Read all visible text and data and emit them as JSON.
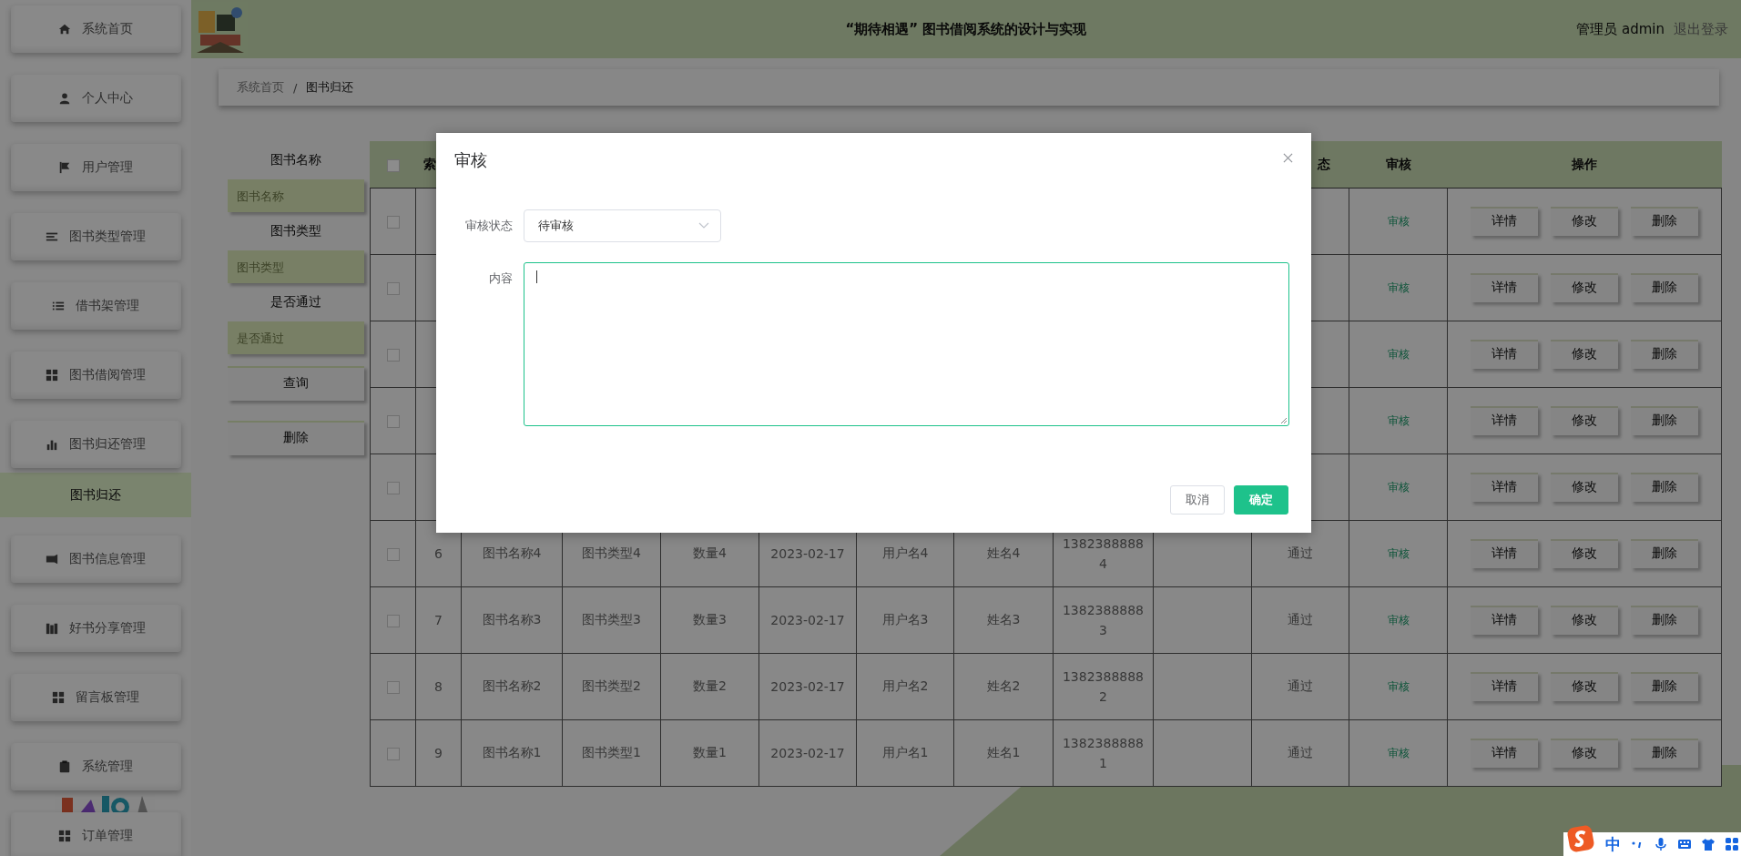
{
  "sidebar": {
    "items": [
      {
        "label": "系统首页",
        "selected": false
      },
      {
        "label": "个人中心",
        "selected": false
      },
      {
        "label": "用户管理",
        "selected": false
      },
      {
        "label": "图书类型管理",
        "selected": false
      },
      {
        "label": "借书架管理",
        "selected": false
      },
      {
        "label": "图书借阅管理",
        "selected": false
      },
      {
        "label": "图书归还管理",
        "selected": false
      },
      {
        "label": "图书归还",
        "selected": true
      },
      {
        "label": "图书信息管理",
        "selected": false
      },
      {
        "label": "好书分享管理",
        "selected": false
      },
      {
        "label": "留言板管理",
        "selected": false
      },
      {
        "label": "系统管理",
        "selected": false
      },
      {
        "label": "订单管理",
        "selected": false
      }
    ]
  },
  "header": {
    "title": "“期待相遇” 图书借阅系统的设计与实现",
    "user": "管理员 admin",
    "logout": "退出登录"
  },
  "breadcrumb": [
    {
      "label": "系统首页"
    },
    {
      "label": "图书归还"
    }
  ],
  "breadcrumb_separator": "/",
  "search": {
    "fields": [
      {
        "label": "图书名称",
        "placeholder": "图书名称"
      },
      {
        "label": "图书类型",
        "placeholder": "图书类型"
      },
      {
        "label": "是否通过",
        "placeholder": "是否通过"
      }
    ],
    "buttons": [
      "查询",
      "删除"
    ]
  },
  "table": {
    "header_checked": false,
    "columns": [
      {
        "label": "索"
      },
      {
        "label": "态"
      },
      {
        "label": "审核"
      },
      {
        "label": "操作"
      }
    ],
    "rows": [
      {
        "checked": false,
        "review": "审核",
        "actions": [
          "详情",
          "修改",
          "删除"
        ]
      },
      {
        "checked": false,
        "review": "审核",
        "actions": [
          "详情",
          "修改",
          "删除"
        ]
      },
      {
        "checked": false,
        "review": "审核",
        "actions": [
          "详情",
          "修改",
          "删除"
        ]
      },
      {
        "checked": false,
        "review": "审核",
        "actions": [
          "详情",
          "修改",
          "删除"
        ]
      },
      {
        "checked": false,
        "review": "审核",
        "actions": [
          "详情",
          "修改",
          "删除"
        ]
      },
      {
        "checked": false,
        "cells": [
          "6",
          "图书名称4",
          "图书类型4",
          "数量4",
          "2023-02-17",
          "用户名4",
          "姓名4",
          "13823888884",
          "",
          "通过"
        ],
        "review": "审核",
        "actions": [
          "详情",
          "修改",
          "删除"
        ]
      },
      {
        "checked": false,
        "cells": [
          "7",
          "图书名称3",
          "图书类型3",
          "数量3",
          "2023-02-17",
          "用户名3",
          "姓名3",
          "13823888883",
          "",
          "通过"
        ],
        "review": "审核",
        "actions": [
          "详情",
          "修改",
          "删除"
        ]
      },
      {
        "checked": false,
        "cells": [
          "8",
          "图书名称2",
          "图书类型2",
          "数量2",
          "2023-02-17",
          "用户名2",
          "姓名2",
          "13823888882",
          "",
          "通过"
        ],
        "review": "审核",
        "actions": [
          "详情",
          "修改",
          "删除"
        ]
      },
      {
        "checked": false,
        "cells": [
          "9",
          "图书名称1",
          "图书类型1",
          "数量1",
          "2023-02-17",
          "用户名1",
          "姓名1",
          "13823888881",
          "",
          "通过"
        ],
        "review": "审核",
        "actions": [
          "详情",
          "修改",
          "删除"
        ]
      }
    ]
  },
  "dialog": {
    "title": "审核",
    "fields": [
      {
        "label": "审核状态",
        "kind": "select",
        "value": "待审核"
      },
      {
        "label": "内容",
        "kind": "textarea",
        "focused": true
      }
    ],
    "buttons": [
      {
        "label": "取消",
        "kind": "default"
      },
      {
        "label": "确定",
        "kind": "primary"
      }
    ]
  },
  "ime_toolbar": {
    "mode": "中"
  }
}
